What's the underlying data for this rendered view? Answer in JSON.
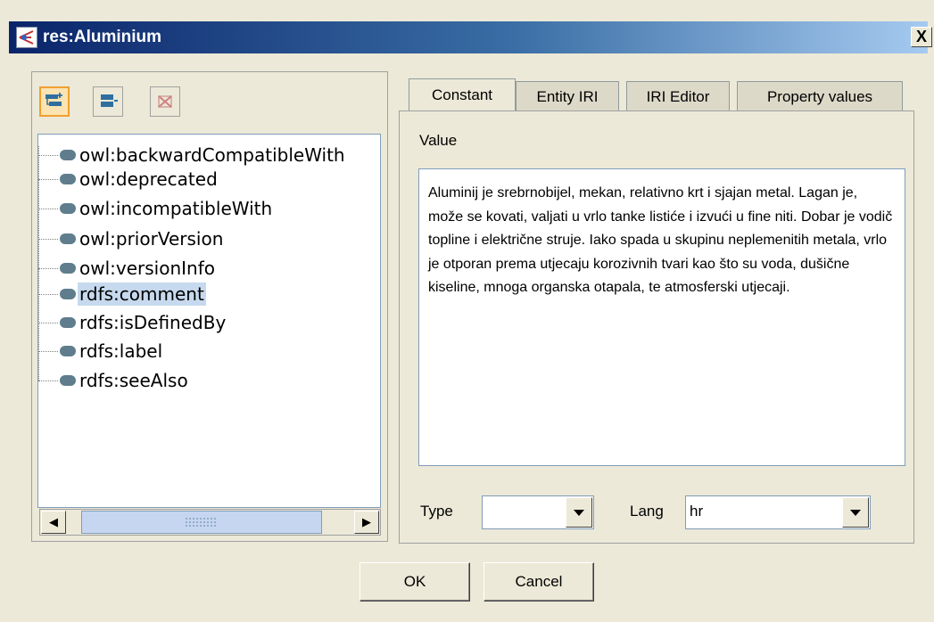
{
  "window": {
    "title": "res:Aluminium",
    "close_glyph": "X"
  },
  "toolbar": {
    "buttons": [
      {
        "icon": "add-subproperty-icon"
      },
      {
        "icon": "add-property-icon"
      },
      {
        "icon": "delete-icon"
      }
    ]
  },
  "tree": {
    "items": [
      "owl:backwardCompatibleWith",
      "owl:deprecated",
      "owl:incompatibleWith",
      "owl:priorVersion",
      "owl:versionInfo",
      "rdfs:comment",
      "rdfs:isDefinedBy",
      "rdfs:label",
      "rdfs:seeAlso"
    ],
    "selected": "rdfs:comment"
  },
  "tabs": [
    {
      "label": "Constant",
      "active": true
    },
    {
      "label": "Entity IRI",
      "active": false
    },
    {
      "label": "IRI Editor",
      "active": false
    },
    {
      "label": "Property values",
      "active": false
    }
  ],
  "editor": {
    "value_label": "Value",
    "text": "Aluminij je srebrnobijel, mekan, relativno krt i sjajan metal. Lagan je, može se kovati, valjati u vrlo tanke listiće i izvući u fine niti. Dobar je vodič topline i električne struje. Iako spada u skupinu neplemenitih metala, vrlo je otporan prema utjecaju korozivnih tvari kao što su voda, dušične kiseline, mnoga organska otapala, te atmosferski utjecaji.",
    "type_label": "Type",
    "type_value": "",
    "lang_label": "Lang",
    "lang_value": "hr"
  },
  "buttons": {
    "ok": "OK",
    "cancel": "Cancel"
  }
}
